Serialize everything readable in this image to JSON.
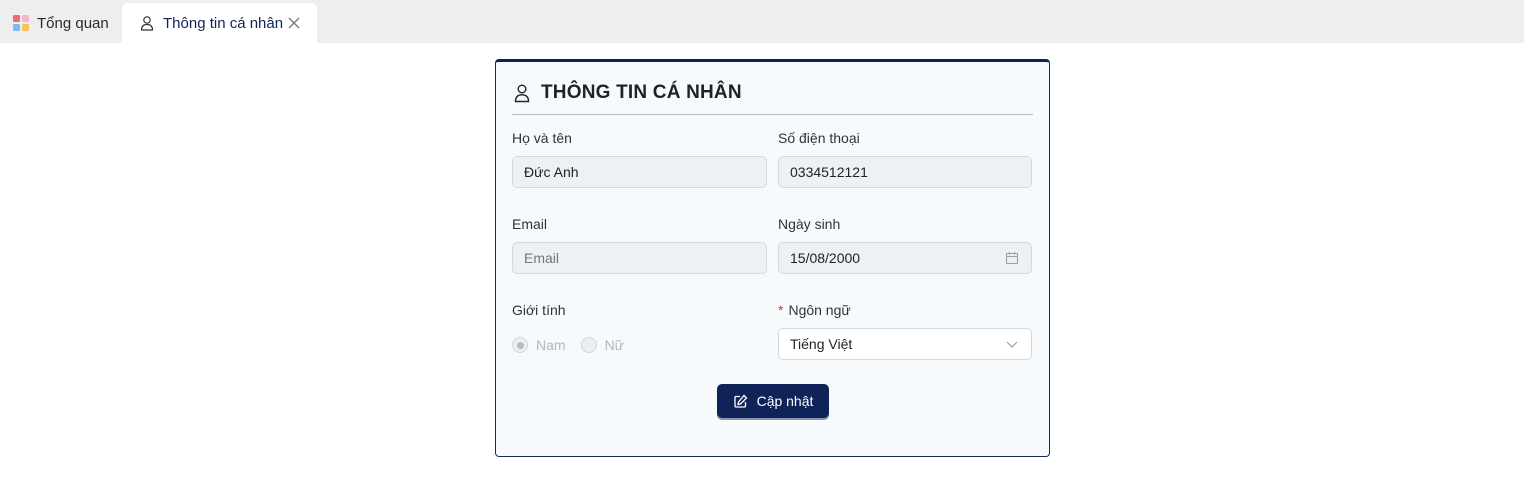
{
  "tabs": [
    {
      "label": "Tổng quan",
      "icon": "dashboard-grid-icon"
    },
    {
      "label": "Thông tin cá nhân",
      "icon": "user-icon",
      "active": true
    }
  ],
  "card": {
    "title": "THÔNG TIN CÁ NHÂN",
    "accent_color": "#0f2358",
    "fields": {
      "full_name": {
        "label": "Họ và tên",
        "value": "Đức Anh"
      },
      "phone": {
        "label": "Số điện thoại",
        "value": "0334512121"
      },
      "email": {
        "label": "Email",
        "value": "",
        "placeholder": "Email"
      },
      "birthday": {
        "label": "Ngày sinh",
        "value": "15/08/2000",
        "icon": "calendar-icon"
      },
      "gender": {
        "label": "Giới tính",
        "options": [
          "Nam",
          "Nữ"
        ],
        "selected": "Nam"
      },
      "language": {
        "label": "Ngôn ngữ",
        "required_mark": "*",
        "value": "Tiếng Việt",
        "icon": "chevron-down-icon"
      }
    },
    "update_button": {
      "label": "Cập nhật",
      "icon": "edit-icon"
    }
  }
}
